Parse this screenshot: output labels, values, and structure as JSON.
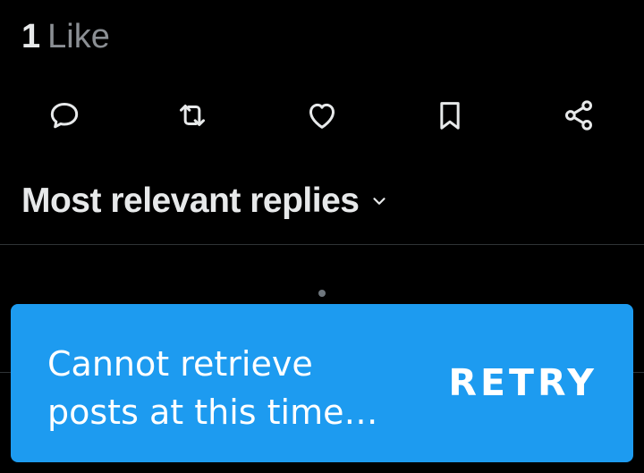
{
  "post": {
    "likes_count": "1",
    "likes_label": "Like"
  },
  "actions": [
    {
      "name": "reply",
      "icon": "reply-bubble-icon"
    },
    {
      "name": "repost",
      "icon": "repost-icon"
    },
    {
      "name": "like",
      "icon": "heart-icon"
    },
    {
      "name": "bookmark",
      "icon": "bookmark-icon"
    },
    {
      "name": "share",
      "icon": "share-icon"
    }
  ],
  "replies": {
    "sort_label": "Most relevant replies",
    "sort_icon": "chevron-down-icon"
  },
  "toast": {
    "message": "Cannot retrieve\nposts at this time…",
    "action_label": "RETRY"
  },
  "colors": {
    "background": "#000000",
    "text_primary": "#e7e9ea",
    "text_secondary": "#8b8f94",
    "icon": "#e7e9ea",
    "divider": "#2f3336",
    "toast_background": "#1d9bf0",
    "toast_text": "#ffffff"
  }
}
